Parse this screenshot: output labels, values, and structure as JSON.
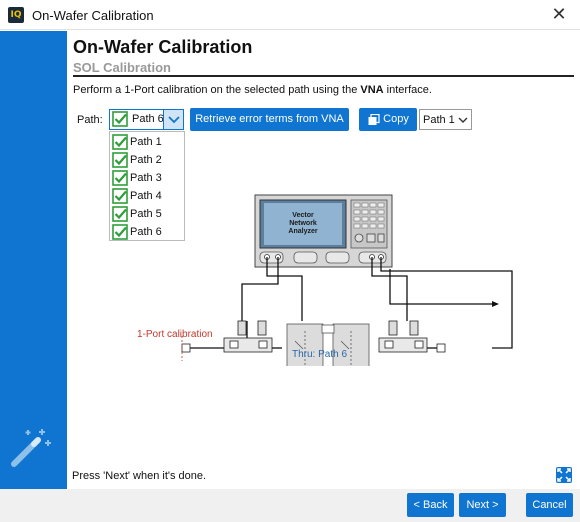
{
  "window": {
    "app_icon_text": "IQ",
    "title": "On-Wafer Calibration",
    "close_glyph": "✕"
  },
  "page": {
    "title": "On-Wafer Calibration",
    "subtitle": "SOL Calibration",
    "instruction_prefix": "Perform a 1-Port calibration on the selected path using the ",
    "instruction_bold": "VNA",
    "instruction_suffix": " interface."
  },
  "path_selector": {
    "label": "Path:",
    "selected": "Path 6",
    "options": [
      "Path 1",
      "Path 2",
      "Path 3",
      "Path 4",
      "Path 5",
      "Path 6"
    ]
  },
  "toolbar": {
    "retrieve_label": "Retrieve error terms from VNA",
    "copy_label": "Copy",
    "copy_target": "Path 1"
  },
  "diagram": {
    "vna_label_line1": "Vector",
    "vna_label_line2": "Network",
    "vna_label_line3": "Analyzer",
    "one_port_label": "1-Port calibration",
    "thru_label": "Thru: Path 6"
  },
  "status_text": "Press 'Next' when it's done.",
  "footer": {
    "back_label": "< Back",
    "next_label": "Next >",
    "cancel_label": "Cancel"
  },
  "colors": {
    "accent": "#0f75d0",
    "calibration_red": "#c0392b",
    "thru_blue": "#2766a8",
    "check_green": "#2e9e3a"
  }
}
